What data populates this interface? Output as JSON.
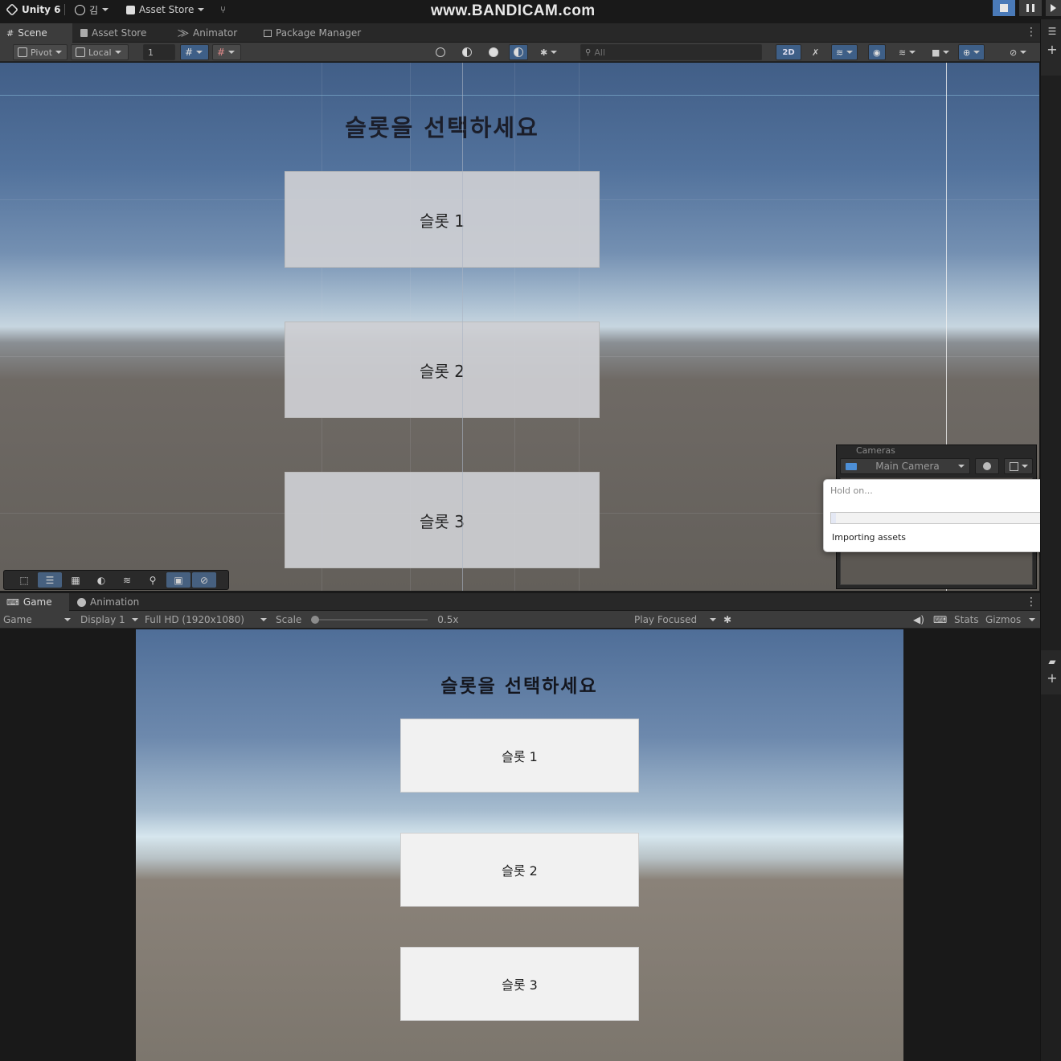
{
  "watermark": "www.BANDICAM.com",
  "topbar": {
    "app_name": "Unity 6",
    "account": "김",
    "asset_store": "Asset Store"
  },
  "scene_tabs": [
    {
      "label": "Scene",
      "icon": "grid-icon",
      "active": true
    },
    {
      "label": "Asset Store",
      "icon": "bag-icon",
      "active": false
    },
    {
      "label": "Animator",
      "icon": "animator-icon",
      "active": false
    },
    {
      "label": "Package Manager",
      "icon": "package-icon",
      "active": false
    }
  ],
  "scene_toolbar": {
    "pivot": "Pivot",
    "local": "Local",
    "grid_value": "1",
    "search_placeholder": "All",
    "mode_2d": "2D"
  },
  "scene": {
    "title": "슬롯을 선택하세요",
    "buttons": [
      "슬롯 1",
      "슬롯 2",
      "슬롯 3"
    ]
  },
  "cameras_overlay": {
    "header": "Cameras",
    "selected_camera": "Main Camera"
  },
  "dialog": {
    "title": "Hold on...",
    "message": "Importing assets",
    "progress": 0.02
  },
  "game_tabs": [
    {
      "label": "Game",
      "icon": "gamepad-icon",
      "active": true
    },
    {
      "label": "Animation",
      "icon": "clock-icon",
      "active": false
    }
  ],
  "game_toolbar": {
    "view_select": "Game",
    "display": "Display 1",
    "resolution": "Full HD (1920x1080)",
    "scale_label": "Scale",
    "scale_value": "0.5x",
    "play_mode": "Play Focused",
    "stats": "Stats",
    "gizmos": "Gizmos"
  },
  "game": {
    "title": "슬롯을 선택하세요",
    "buttons": [
      "슬롯 1",
      "슬롯 2",
      "슬롯 3"
    ]
  },
  "colors": {
    "accent": "#3e5f87",
    "editor_bg": "#282828",
    "toolbar_bg": "#3c3c3c"
  }
}
